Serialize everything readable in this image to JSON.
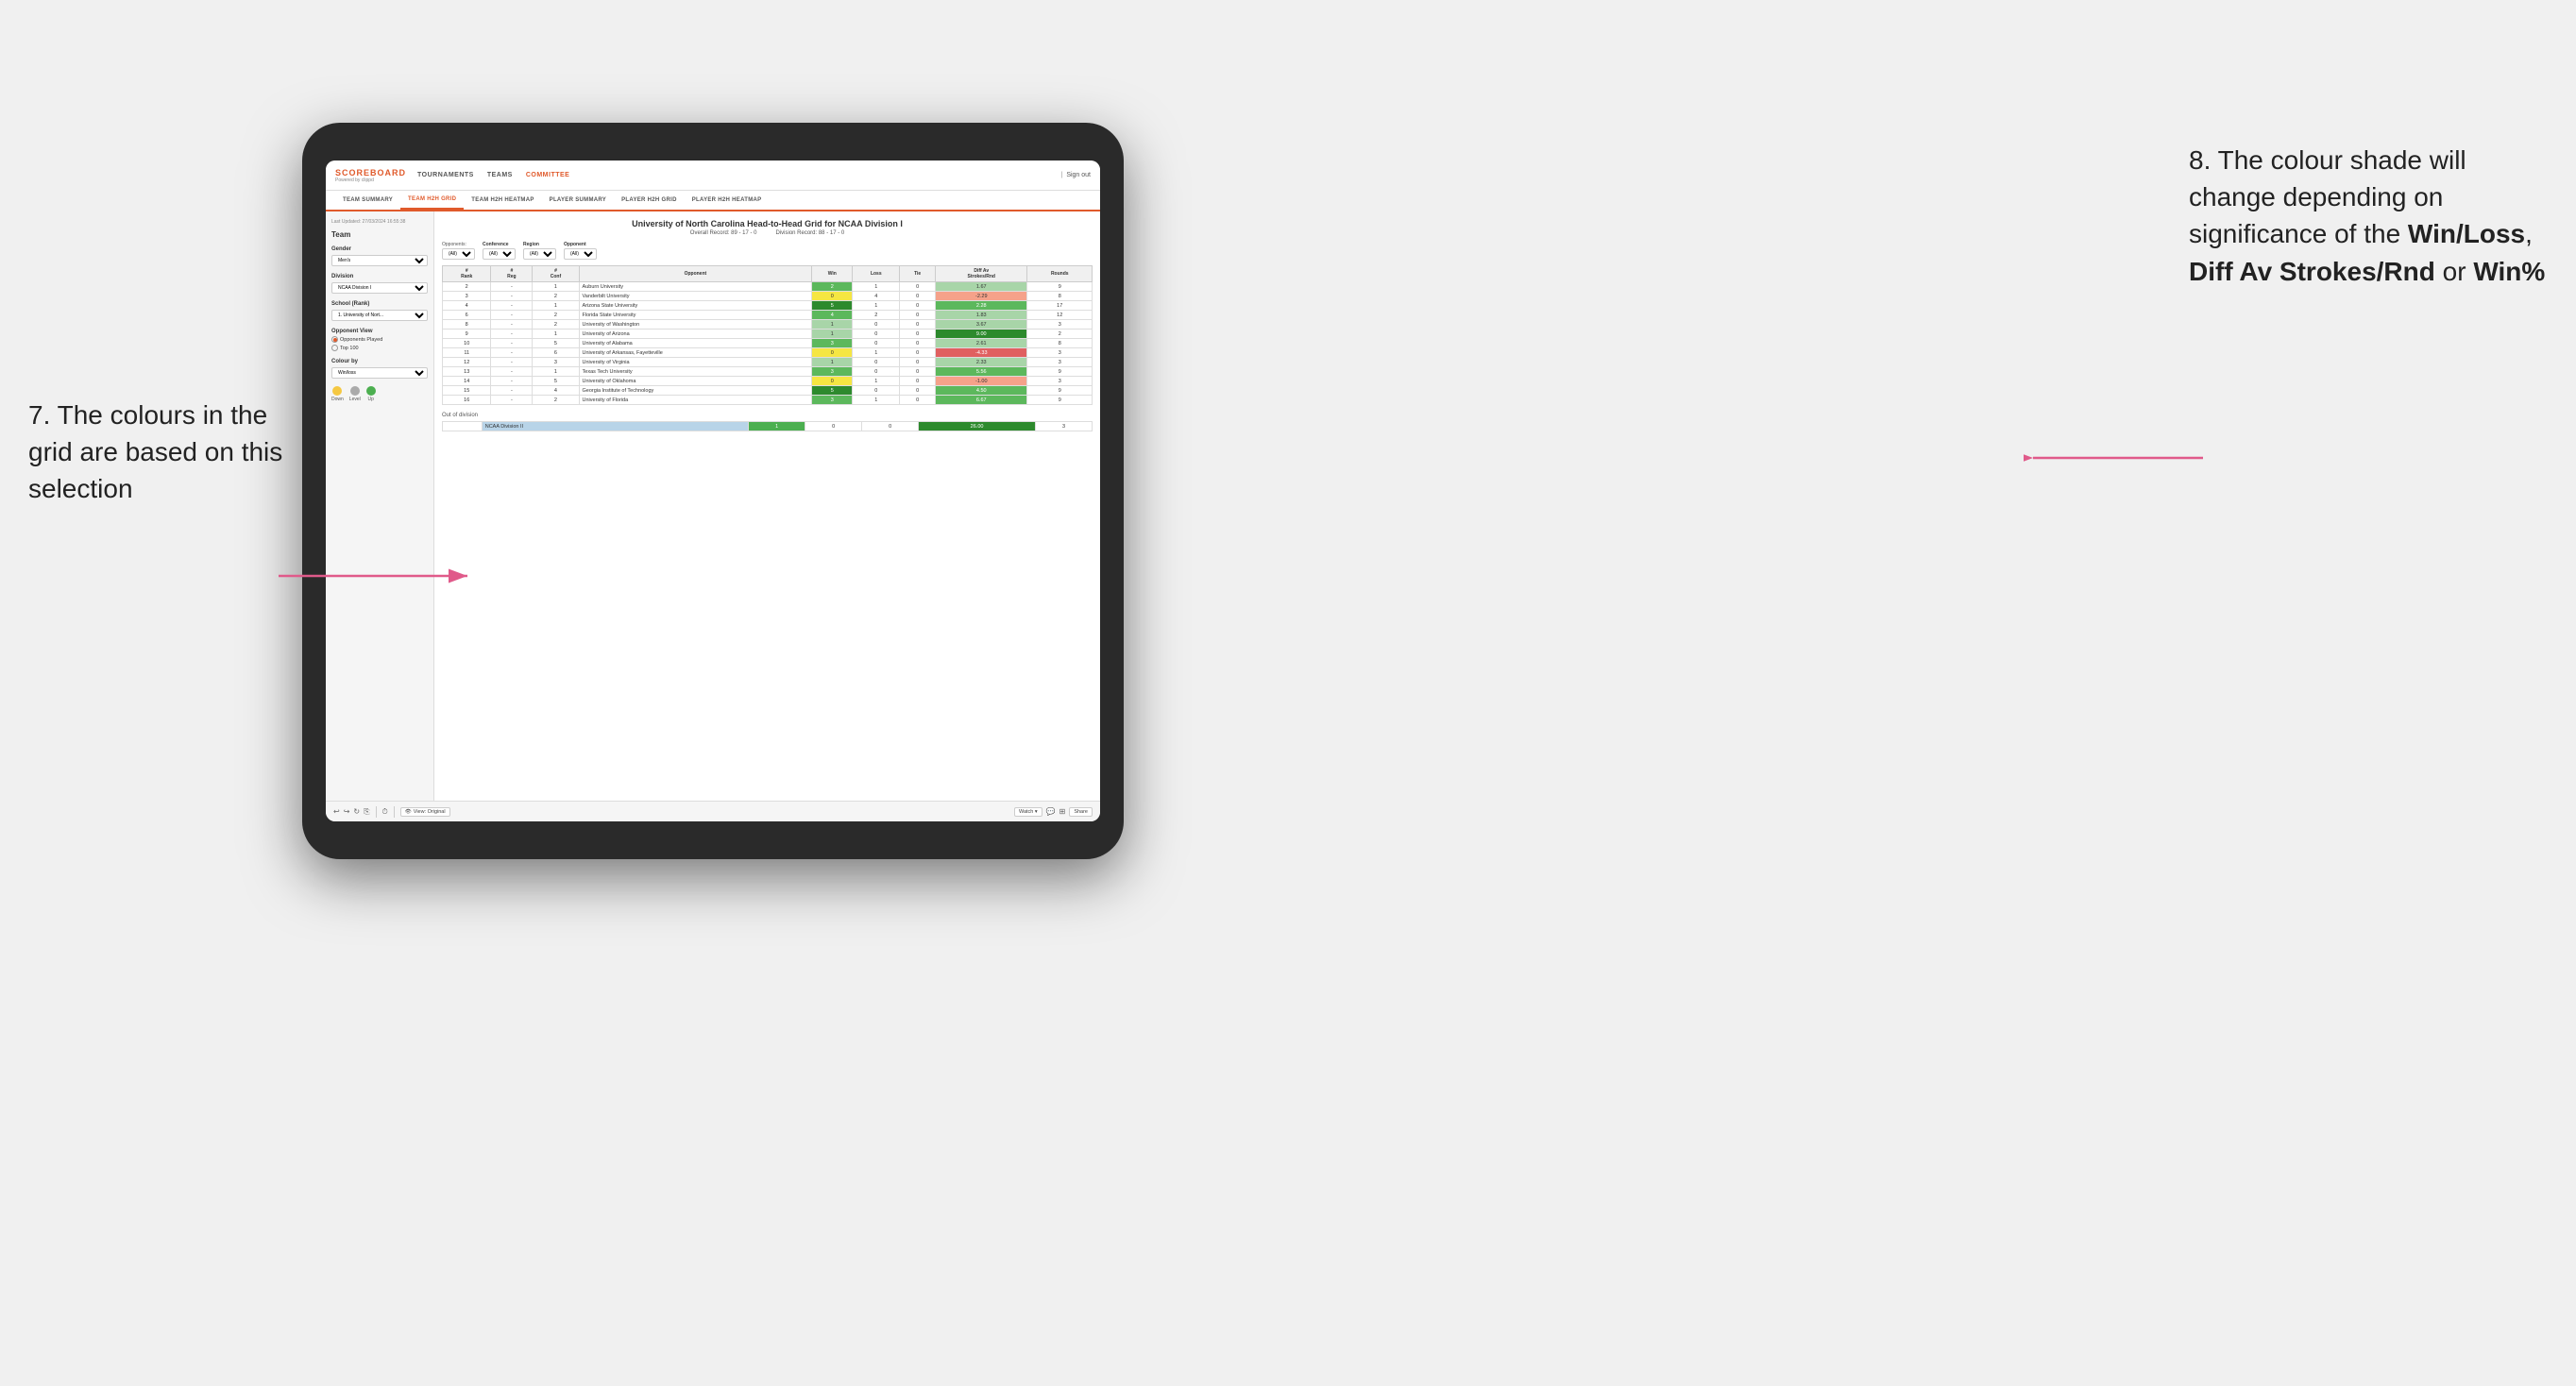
{
  "annotations": {
    "left": {
      "text": "7. The colours in the grid are based on this selection"
    },
    "right": {
      "line1": "8. The colour shade will change depending on significance of the ",
      "bold1": "Win/Loss",
      "line2": ", ",
      "bold2": "Diff Av Strokes/Rnd",
      "line3": " or ",
      "bold3": "Win%"
    }
  },
  "nav": {
    "logo": "SCOREBOARD",
    "logo_sub": "Powered by clippd",
    "links": [
      "TOURNAMENTS",
      "TEAMS",
      "COMMITTEE"
    ],
    "sign_out": "Sign out"
  },
  "sub_tabs": [
    "TEAM SUMMARY",
    "TEAM H2H GRID",
    "TEAM H2H HEATMAP",
    "PLAYER SUMMARY",
    "PLAYER H2H GRID",
    "PLAYER H2H HEATMAP"
  ],
  "active_sub_tab": "TEAM H2H GRID",
  "sidebar": {
    "timestamp": "Last Updated: 27/03/2024 16:55:38",
    "team_label": "Team",
    "gender_label": "Gender",
    "gender_value": "Men's",
    "division_label": "Division",
    "division_value": "NCAA Division I",
    "school_label": "School (Rank)",
    "school_value": "1. University of Nort...",
    "opponent_view_label": "Opponent View",
    "radio_options": [
      "Opponents Played",
      "Top 100"
    ],
    "selected_radio": "Opponents Played",
    "colour_by_label": "Colour by",
    "colour_by_value": "Win/loss",
    "legend": {
      "down": "Down",
      "level": "Level",
      "up": "Up"
    }
  },
  "grid": {
    "title": "University of North Carolina Head-to-Head Grid for NCAA Division I",
    "overall_record": "Overall Record: 89 - 17 - 0",
    "division_record": "Division Record: 88 - 17 - 0",
    "filters": {
      "opponents_label": "Opponents:",
      "opponents_value": "(All)",
      "conference_label": "Conference",
      "conference_value": "(All)",
      "region_label": "Region",
      "region_value": "(All)",
      "opponent_label": "Opponent",
      "opponent_value": "(All)"
    },
    "columns": [
      "#Rank",
      "#Reg",
      "#Conf",
      "Opponent",
      "Win",
      "Loss",
      "Tie",
      "Diff Av Strokes/Rnd",
      "Rounds"
    ],
    "rows": [
      {
        "rank": "2",
        "reg": "-",
        "conf": "1",
        "opponent": "Auburn University",
        "win": "2",
        "loss": "1",
        "tie": "0",
        "diff": "1.67",
        "rounds": "9",
        "win_color": "green-mid",
        "diff_color": "green-light"
      },
      {
        "rank": "3",
        "reg": "-",
        "conf": "2",
        "opponent": "Vanderbilt University",
        "win": "0",
        "loss": "4",
        "tie": "0",
        "diff": "-2.29",
        "rounds": "8",
        "win_color": "yellow",
        "diff_color": "red-light"
      },
      {
        "rank": "4",
        "reg": "-",
        "conf": "1",
        "opponent": "Arizona State University",
        "win": "5",
        "loss": "1",
        "tie": "0",
        "diff": "2.28",
        "rounds": "17",
        "win_color": "green-dark",
        "diff_color": "green-mid"
      },
      {
        "rank": "6",
        "reg": "-",
        "conf": "2",
        "opponent": "Florida State University",
        "win": "4",
        "loss": "2",
        "tie": "0",
        "diff": "1.83",
        "rounds": "12",
        "win_color": "green-mid",
        "diff_color": "green-light"
      },
      {
        "rank": "8",
        "reg": "-",
        "conf": "2",
        "opponent": "University of Washington",
        "win": "1",
        "loss": "0",
        "tie": "0",
        "diff": "3.67",
        "rounds": "3",
        "win_color": "green-light",
        "diff_color": "green-light"
      },
      {
        "rank": "9",
        "reg": "-",
        "conf": "1",
        "opponent": "University of Arizona",
        "win": "1",
        "loss": "0",
        "tie": "0",
        "diff": "9.00",
        "rounds": "2",
        "win_color": "green-light",
        "diff_color": "green-dark"
      },
      {
        "rank": "10",
        "reg": "-",
        "conf": "5",
        "opponent": "University of Alabama",
        "win": "3",
        "loss": "0",
        "tie": "0",
        "diff": "2.61",
        "rounds": "8",
        "win_color": "green-mid",
        "diff_color": "green-light"
      },
      {
        "rank": "11",
        "reg": "-",
        "conf": "6",
        "opponent": "University of Arkansas, Fayetteville",
        "win": "0",
        "loss": "1",
        "tie": "0",
        "diff": "-4.33",
        "rounds": "3",
        "win_color": "yellow",
        "diff_color": "red-mid"
      },
      {
        "rank": "12",
        "reg": "-",
        "conf": "3",
        "opponent": "University of Virginia",
        "win": "1",
        "loss": "0",
        "tie": "0",
        "diff": "2.33",
        "rounds": "3",
        "win_color": "green-light",
        "diff_color": "green-light"
      },
      {
        "rank": "13",
        "reg": "-",
        "conf": "1",
        "opponent": "Texas Tech University",
        "win": "3",
        "loss": "0",
        "tie": "0",
        "diff": "5.56",
        "rounds": "9",
        "win_color": "green-mid",
        "diff_color": "green-mid"
      },
      {
        "rank": "14",
        "reg": "-",
        "conf": "5",
        "opponent": "University of Oklahoma",
        "win": "0",
        "loss": "1",
        "tie": "0",
        "diff": "-1.00",
        "rounds": "3",
        "win_color": "yellow",
        "diff_color": "red-light"
      },
      {
        "rank": "15",
        "reg": "-",
        "conf": "4",
        "opponent": "Georgia Institute of Technology",
        "win": "5",
        "loss": "0",
        "tie": "0",
        "diff": "4.50",
        "rounds": "9",
        "win_color": "green-dark",
        "diff_color": "green-mid"
      },
      {
        "rank": "16",
        "reg": "-",
        "conf": "2",
        "opponent": "University of Florida",
        "win": "3",
        "loss": "1",
        "tie": "0",
        "diff": "6.67",
        "rounds": "9",
        "win_color": "green-mid",
        "diff_color": "green-mid"
      }
    ],
    "out_of_division_label": "Out of division",
    "out_of_division_row": {
      "division": "NCAA Division II",
      "win": "1",
      "loss": "0",
      "tie": "0",
      "diff": "26.00",
      "rounds": "3",
      "diff_color": "green-dark"
    }
  },
  "toolbar": {
    "view_label": "View: Original",
    "watch_label": "Watch ▾",
    "share_label": "Share"
  }
}
